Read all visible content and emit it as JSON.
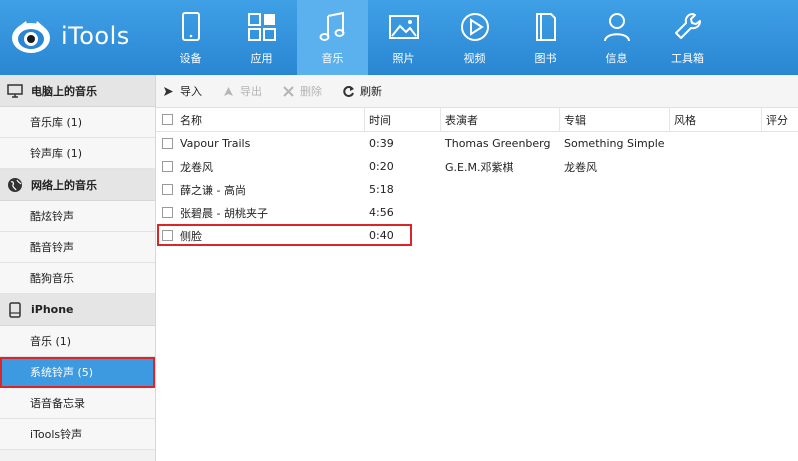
{
  "app": {
    "title": "iTools"
  },
  "nav": [
    {
      "label": "设备",
      "icon": "tablet-icon"
    },
    {
      "label": "应用",
      "icon": "apps-grid-icon"
    },
    {
      "label": "音乐",
      "icon": "music-note-icon",
      "active": true
    },
    {
      "label": "照片",
      "icon": "photo-icon"
    },
    {
      "label": "视频",
      "icon": "play-circle-icon"
    },
    {
      "label": "图书",
      "icon": "book-icon"
    },
    {
      "label": "信息",
      "icon": "person-icon"
    },
    {
      "label": "工具箱",
      "icon": "wrench-icon"
    }
  ],
  "sidebar": {
    "pc_header": "电脑上的音乐",
    "pc_items": [
      "音乐库 (1)",
      "铃声库 (1)"
    ],
    "net_header": "网络上的音乐",
    "net_items": [
      "酷炫铃声",
      "酷音铃声",
      "酷狗音乐"
    ],
    "device_header": "iPhone",
    "device_items": [
      "音乐 (1)",
      "系统铃声 (5)",
      "语音备忘录",
      "iTools铃声"
    ],
    "selected": "系统铃声 (5)"
  },
  "toolbar": {
    "import": "导入",
    "export": "导出",
    "delete": "删除",
    "refresh": "刷新"
  },
  "table": {
    "headers": {
      "name": "名称",
      "time": "时间",
      "artist": "表演者",
      "album": "专辑",
      "genre": "风格",
      "rating": "评分"
    },
    "rows": [
      {
        "name": "Vapour Trails",
        "time": "0:39",
        "artist": "Thomas Greenberg",
        "album": "Something Simple"
      },
      {
        "name": "龙卷风",
        "time": "0:20",
        "artist": "G.E.M.邓紫棋",
        "album": "龙卷风"
      },
      {
        "name": "薛之谦 - 高尚",
        "time": "5:18",
        "artist": "",
        "album": ""
      },
      {
        "name": "张碧晨 - 胡桃夹子",
        "time": "4:56",
        "artist": "",
        "album": ""
      },
      {
        "name": "侧脸",
        "time": "0:40",
        "artist": "",
        "album": ""
      }
    ]
  },
  "colors": {
    "topbar": "#2a86d2",
    "accent": "#3e9ae0",
    "highlight": "#d9262a"
  }
}
